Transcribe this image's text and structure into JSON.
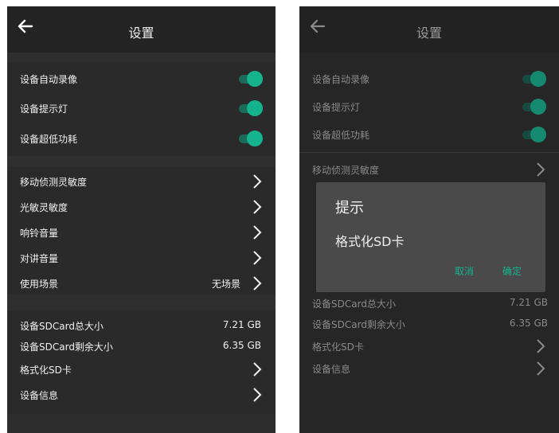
{
  "colors": {
    "accent": "#16b38f",
    "background": "#2a2a2a",
    "dialog": "#4a4a4a"
  },
  "left": {
    "header": {
      "title": "设置",
      "back_icon": "arrow-left-icon"
    },
    "toggles": [
      {
        "label": "设备自动录像",
        "on": true
      },
      {
        "label": "设备提示灯",
        "on": true
      },
      {
        "label": "设备超低功耗",
        "on": true
      }
    ],
    "nav_items": [
      {
        "label": "移动侦测灵敏度"
      },
      {
        "label": "光敏灵敏度"
      },
      {
        "label": "响铃音量"
      },
      {
        "label": "对讲音量"
      },
      {
        "label": "使用场景",
        "value": "无场景"
      }
    ],
    "storage": [
      {
        "label": "设备SDCard总大小",
        "value": "7.21 GB"
      },
      {
        "label": "设备SDCard剩余大小",
        "value": "6.35 GB"
      }
    ],
    "bottom_items": [
      {
        "label": "格式化SD卡"
      },
      {
        "label": "设备信息"
      }
    ]
  },
  "right": {
    "header": {
      "title": "设置",
      "back_icon": "arrow-left-icon"
    },
    "toggles": [
      {
        "label": "设备自动录像",
        "on": true
      },
      {
        "label": "设备提示灯",
        "on": true
      },
      {
        "label": "设备超低功耗",
        "on": true
      }
    ],
    "nav_items": [
      {
        "label": "移动侦测灵敏度"
      }
    ],
    "storage": [
      {
        "label": "设备SDCard总大小",
        "value": "7.21 GB"
      },
      {
        "label": "设备SDCard剩余大小",
        "value": "6.35 GB"
      }
    ],
    "bottom_items": [
      {
        "label": "格式化SD卡"
      },
      {
        "label": "设备信息"
      }
    ],
    "dialog": {
      "title": "提示",
      "message": "格式化SD卡",
      "cancel_label": "取消",
      "ok_label": "确定"
    }
  }
}
